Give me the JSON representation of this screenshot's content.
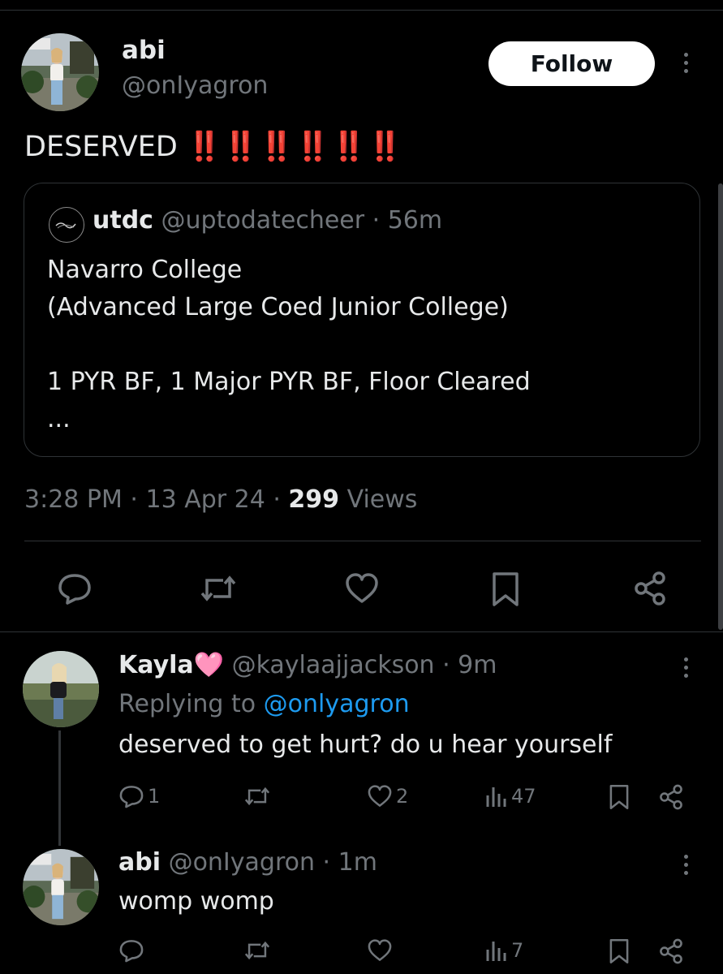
{
  "main_tweet": {
    "author_name": "abi",
    "author_handle": "@onIyagron",
    "follow_label": "Follow",
    "text": "DESERVED",
    "emphasis": "‼️‼️‼️‼️‼️‼️",
    "timestamp": "3:28 PM · 13 Apr 24 · ",
    "views_count": "299",
    "views_label": " Views"
  },
  "quoted_tweet": {
    "author_name": "utdc",
    "author_handle": "@uptodatecheer · 56m",
    "body": "Navarro College\n(Advanced Large Coed Junior College)\n\n1 PYR BF, 1 Major PYR BF, Floor Cleared\n..."
  },
  "replies": [
    {
      "author_name": "Kayla🩷",
      "author_handle": "@kaylaajjackson · 9m",
      "replying_prefix": "Replying to ",
      "replying_to": "@onlyagron",
      "text": "deserved to get hurt? do u hear yourself",
      "reply_count": "1",
      "retweet_count": "",
      "like_count": "2",
      "view_count": "47"
    },
    {
      "author_name": "abi",
      "author_handle": "@onIyagron · 1m",
      "text": "womp womp",
      "reply_count": "",
      "retweet_count": "",
      "like_count": "",
      "view_count": "7"
    }
  ],
  "colors": {
    "background": "#000000",
    "text_primary": "#e7e9ea",
    "text_secondary": "#71767b",
    "link": "#1d9bf0",
    "emphasis_red": "#e0211a",
    "border": "#2f3336"
  },
  "icons": [
    "reply-icon",
    "retweet-icon",
    "like-icon",
    "bookmark-icon",
    "share-icon",
    "views-icon",
    "more-icon"
  ]
}
